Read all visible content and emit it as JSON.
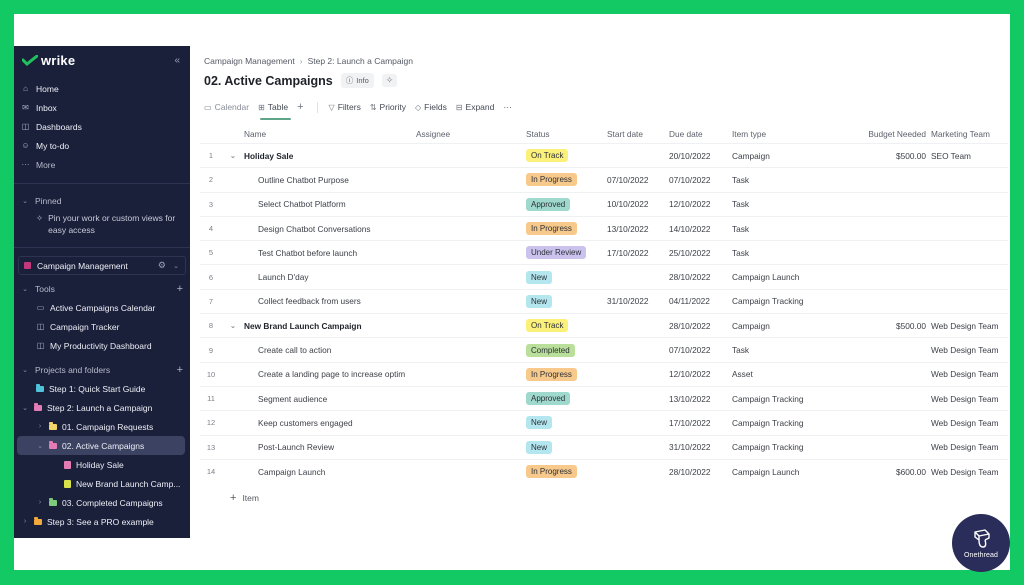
{
  "sidebar": {
    "brand": "wrike",
    "nav": [
      {
        "label": "Home",
        "icon": "home-icon"
      },
      {
        "label": "Inbox",
        "icon": "inbox-icon"
      },
      {
        "label": "Dashboards",
        "icon": "dashboard-icon"
      },
      {
        "label": "My to-do",
        "icon": "user-todo-icon"
      },
      {
        "label": "More",
        "icon": "more-icon"
      }
    ],
    "pinned": {
      "heading": "Pinned",
      "hint": "Pin your work or custom views for easy access"
    },
    "space": {
      "label": "Campaign Management",
      "color": "#c2387a"
    },
    "tools": {
      "heading": "Tools",
      "items": [
        {
          "label": "Active Campaigns Calendar",
          "icon": "calendar-icon"
        },
        {
          "label": "Campaign Tracker",
          "icon": "dashboard-icon"
        },
        {
          "label": "My Productivity Dashboard",
          "icon": "dashboard-icon"
        }
      ]
    },
    "projects": {
      "heading": "Projects and folders",
      "items": [
        {
          "label": "Step 1: Quick Start Guide",
          "color": "#4fc3d9"
        },
        {
          "label": "Step 2: Launch a Campaign",
          "color": "#e37bb4"
        },
        {
          "label": "01. Campaign Requests",
          "color": "#f2d46b"
        },
        {
          "label": "02. Active Campaigns",
          "color": "#e37bb4"
        },
        {
          "label": "Holiday Sale",
          "color": "#e37bb4"
        },
        {
          "label": "New Brand Launch Camp...",
          "color": "#d8e04a"
        },
        {
          "label": "03. Completed Campaigns",
          "color": "#7fc97a"
        },
        {
          "label": "Step 3: See a PRO example",
          "color": "#f2a93b"
        }
      ]
    }
  },
  "main": {
    "breadcrumb": [
      "Campaign Management",
      "Step 2: Launch a Campaign"
    ],
    "title": "02. Active Campaigns",
    "info_label": "Info",
    "toolbar": {
      "calendar": "Calendar",
      "table": "Table",
      "filters": "Filters",
      "priority": "Priority",
      "fields": "Fields",
      "expand": "Expand",
      "more": "···"
    },
    "columns": {
      "name": "Name",
      "assignee": "Assignee",
      "status": "Status",
      "start": "Start date",
      "due": "Due date",
      "type": "Item type",
      "budget": "Budget Needed",
      "team": "Marketing Team"
    },
    "statuses": {
      "On Track": "#fbf07a",
      "In Progress": "#f7c98a",
      "Approved": "#9fd8cc",
      "Under Review": "#cbc3ee",
      "New": "#b4e6ef",
      "Completed": "#b9df9b"
    },
    "rows": [
      {
        "num": "1",
        "name": "Holiday Sale",
        "parent": true,
        "status": "On Track",
        "start": "",
        "due": "20/10/2022",
        "type": "Campaign",
        "budget": "$500.00",
        "team": "SEO Team"
      },
      {
        "num": "2",
        "name": "Outline Chatbot Purpose",
        "parent": false,
        "status": "In Progress",
        "start": "07/10/2022",
        "due": "07/10/2022",
        "type": "Task",
        "budget": "",
        "team": ""
      },
      {
        "num": "3",
        "name": "Select Chatbot Platform",
        "parent": false,
        "status": "Approved",
        "start": "10/10/2022",
        "due": "12/10/2022",
        "type": "Task",
        "budget": "",
        "team": ""
      },
      {
        "num": "4",
        "name": "Design Chatbot Conversations",
        "parent": false,
        "status": "In Progress",
        "start": "13/10/2022",
        "due": "14/10/2022",
        "type": "Task",
        "budget": "",
        "team": ""
      },
      {
        "num": "5",
        "name": "Test Chatbot before launch",
        "parent": false,
        "status": "Under Review",
        "start": "17/10/2022",
        "due": "25/10/2022",
        "type": "Task",
        "budget": "",
        "team": ""
      },
      {
        "num": "6",
        "name": "Launch D'day",
        "parent": false,
        "status": "New",
        "start": "",
        "due": "28/10/2022",
        "type": "Campaign Launch",
        "budget": "",
        "team": ""
      },
      {
        "num": "7",
        "name": "Collect feedback from users",
        "parent": false,
        "status": "New",
        "start": "31/10/2022",
        "due": "04/11/2022",
        "type": "Campaign Tracking",
        "budget": "",
        "team": ""
      },
      {
        "num": "8",
        "name": "New Brand Launch Campaign",
        "parent": true,
        "status": "On Track",
        "start": "",
        "due": "28/10/2022",
        "type": "Campaign",
        "budget": "$500.00",
        "team": "Web Design Team"
      },
      {
        "num": "9",
        "name": "Create call to action",
        "parent": false,
        "status": "Completed",
        "start": "",
        "due": "07/10/2022",
        "type": "Task",
        "budget": "",
        "team": "Web Design Team"
      },
      {
        "num": "10",
        "name": "Create a landing page to increase optim",
        "parent": false,
        "status": "In Progress",
        "start": "",
        "due": "12/10/2022",
        "type": "Asset",
        "budget": "",
        "team": "Web Design Team"
      },
      {
        "num": "11",
        "name": "Segment audience",
        "parent": false,
        "status": "Approved",
        "start": "",
        "due": "13/10/2022",
        "type": "Campaign Tracking",
        "budget": "",
        "team": "Web Design Team"
      },
      {
        "num": "12",
        "name": "Keep customers engaged",
        "parent": false,
        "status": "New",
        "start": "",
        "due": "17/10/2022",
        "type": "Campaign Tracking",
        "budget": "",
        "team": "Web Design Team"
      },
      {
        "num": "13",
        "name": "Post-Launch Review",
        "parent": false,
        "status": "New",
        "start": "",
        "due": "31/10/2022",
        "type": "Campaign Tracking",
        "budget": "",
        "team": "Web Design Team"
      },
      {
        "num": "14",
        "name": "Campaign Launch",
        "parent": false,
        "status": "In Progress",
        "start": "",
        "due": "28/10/2022",
        "type": "Campaign Launch",
        "budget": "$600.00",
        "team": "Web Design Team"
      }
    ],
    "add_item_label": "Item"
  },
  "watermark": {
    "label": "Onethread"
  }
}
